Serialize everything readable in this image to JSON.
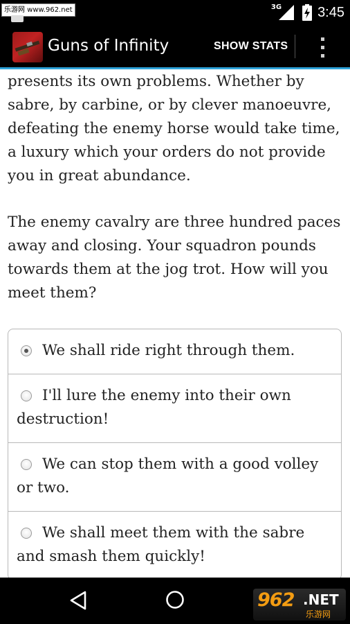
{
  "status_bar": {
    "watermark": "乐游网 www.962.net",
    "network": "3G",
    "time": "3:45"
  },
  "app_bar": {
    "title": "Guns of Infinity",
    "show_stats_label": "SHOW STATS",
    "overflow_icon": "more-vert-icon",
    "accent_color": "#2ea3d9"
  },
  "story": {
    "paragraphs": [
      "presents its own problems. Whether by sabre, by carbine, or by clever manoeuvre, defeating the enemy horse would take time, a luxury which your orders do not provide you in great abundance.",
      "The enemy cavalry are three hundred paces away and closing. Your squadron pounds towards them at the jog trot. How will you meet them?"
    ]
  },
  "choices": [
    {
      "label": "We shall ride right through them.",
      "selected": true
    },
    {
      "label": "I'll lure the enemy into their own destruction!",
      "selected": false
    },
    {
      "label": "We can stop them with a good volley or two.",
      "selected": false
    },
    {
      "label": "We shall meet them with the sabre and smash them quickly!",
      "selected": false
    }
  ],
  "nav_bar": {
    "back_icon": "back-triangle-icon",
    "home_icon": "home-circle-icon",
    "watermark_number": "962",
    "watermark_net": ".NET",
    "watermark_sub": "乐游网"
  }
}
